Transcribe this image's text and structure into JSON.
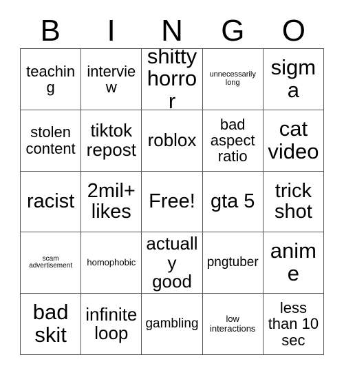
{
  "card": {
    "header_letters": [
      "B",
      "I",
      "N",
      "G",
      "O"
    ],
    "free_space_label": "Free!",
    "rows": [
      [
        {
          "text": "teaching",
          "size": "md"
        },
        {
          "text": "interview",
          "size": "md"
        },
        {
          "text": "shitty\nhorror",
          "size": "xxl"
        },
        {
          "text": "unnecessarily\nlong",
          "size": "tiny"
        },
        {
          "text": "sigma",
          "size": "xxl"
        }
      ],
      [
        {
          "text": "stolen\ncontent",
          "size": "md"
        },
        {
          "text": "tiktok\nrepost",
          "size": "lg"
        },
        {
          "text": "roblox",
          "size": "lg"
        },
        {
          "text": "bad\naspect\nratio",
          "size": "md"
        },
        {
          "text": "cat\nvideo",
          "size": "xxl"
        }
      ],
      [
        {
          "text": "racist",
          "size": "xl"
        },
        {
          "text": "2mil+\nlikes",
          "size": "xl"
        },
        {
          "text": "Free!",
          "size": "xl"
        },
        {
          "text": "gta 5",
          "size": "xl"
        },
        {
          "text": "trick\nshot",
          "size": "xl"
        }
      ],
      [
        {
          "text": "scam\nadvertisement",
          "size": "micro"
        },
        {
          "text": "homophobic",
          "size": "xxs"
        },
        {
          "text": "actually\ngood",
          "size": "lg"
        },
        {
          "text": "pngtuber",
          "size": "sm"
        },
        {
          "text": "anime",
          "size": "xxl"
        }
      ],
      [
        {
          "text": "bad\nskit",
          "size": "xxl"
        },
        {
          "text": "infinite\nloop",
          "size": "lg"
        },
        {
          "text": "gambling",
          "size": "sm"
        },
        {
          "text": "low\ninteractions",
          "size": "xxs"
        },
        {
          "text": "less\nthan 10\nsec",
          "size": "md"
        }
      ]
    ]
  },
  "colors": {
    "background": "#ffffff",
    "text": "#000000",
    "grid_line": "#555555"
  }
}
